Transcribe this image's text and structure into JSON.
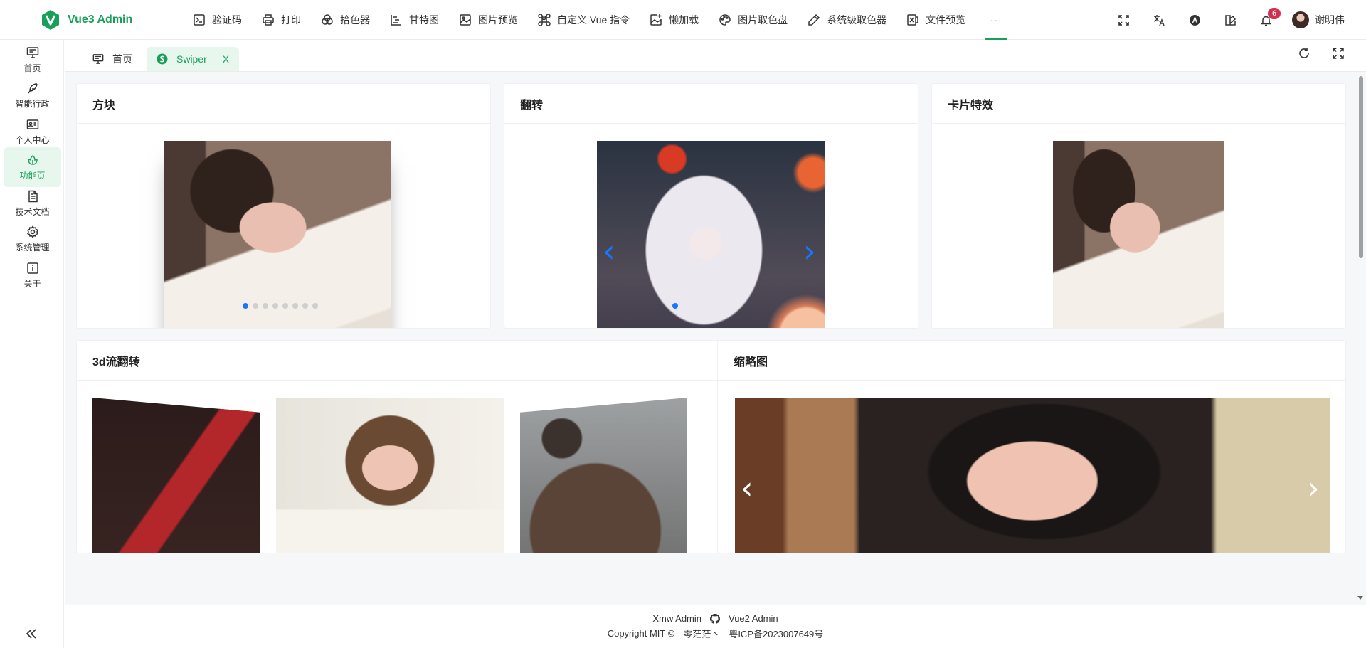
{
  "brand": {
    "title": "Vue3 Admin"
  },
  "topnav": {
    "items": [
      {
        "label": "验证码",
        "icon": "terminal-icon"
      },
      {
        "label": "打印",
        "icon": "printer-icon"
      },
      {
        "label": "拾色器",
        "icon": "color-circles-icon"
      },
      {
        "label": "甘特图",
        "icon": "gantt-chart-icon"
      },
      {
        "label": "图片预览",
        "icon": "image-icon"
      },
      {
        "label": "自定义 Vue 指令",
        "icon": "command-icon"
      },
      {
        "label": "懒加载",
        "icon": "image-plus-icon"
      },
      {
        "label": "图片取色盘",
        "icon": "palette-icon"
      },
      {
        "label": "系统级取色器",
        "icon": "pen-icon"
      },
      {
        "label": "文件预览",
        "icon": "excel-file-icon"
      }
    ],
    "more": "···"
  },
  "header_right": {
    "notifications_count": "6",
    "user_name": "谢明伟"
  },
  "sidebar": {
    "items": [
      {
        "label": "首页",
        "icon": "monitor-icon"
      },
      {
        "label": "智能行政",
        "icon": "feather-icon"
      },
      {
        "label": "个人中心",
        "icon": "id-card-icon"
      },
      {
        "label": "功能页",
        "icon": "lotus-icon",
        "active": true
      },
      {
        "label": "技术文档",
        "icon": "document-icon"
      },
      {
        "label": "系统管理",
        "icon": "settings-icon"
      },
      {
        "label": "关于",
        "icon": "info-icon"
      }
    ]
  },
  "tabs": [
    {
      "label": "首页",
      "icon": "monitor-icon"
    },
    {
      "label": "Swiper",
      "icon": "swiper-icon",
      "active": true,
      "close": "X"
    }
  ],
  "cards": {
    "cube": {
      "title": "方块"
    },
    "flip": {
      "title": "翻转"
    },
    "cards_effect": {
      "title": "卡片特效"
    },
    "coverflow": {
      "title": "3d流翻转"
    },
    "thumbs": {
      "title": "缩略图"
    }
  },
  "footer": {
    "link1": "Xmw Admin",
    "link2": "Vue2 Admin",
    "copyright": "Copyright MIT ©",
    "author": "零茫茫丶",
    "icp": "粤ICP备2023007649号"
  },
  "colors": {
    "accent": "#18a058",
    "accent_light": "#e8f7ee",
    "badge": "#d03050",
    "swiper_blue": "#1677ff"
  }
}
